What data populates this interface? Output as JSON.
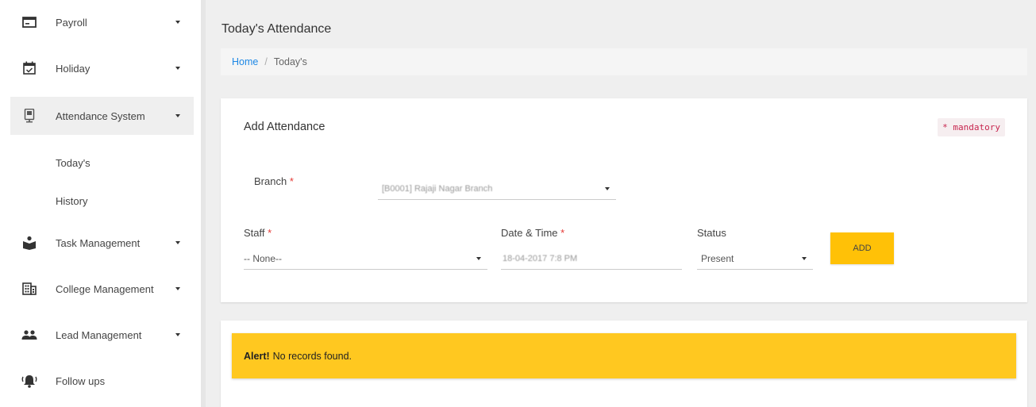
{
  "sidebar": {
    "items": [
      {
        "label": "Payroll",
        "icon": "payroll-icon"
      },
      {
        "label": "Holiday",
        "icon": "calendar-check-icon"
      },
      {
        "label": "Attendance System",
        "icon": "attendance-icon"
      },
      {
        "label": "Task Management",
        "icon": "task-icon"
      },
      {
        "label": "College Management",
        "icon": "building-icon"
      },
      {
        "label": "Lead Management",
        "icon": "people-icon"
      },
      {
        "label": "Follow ups",
        "icon": "bell-icon"
      }
    ],
    "subitems": [
      "Today's",
      "History"
    ]
  },
  "header": {
    "title": "Today's Attendance",
    "breadcrumb": {
      "home": "Home",
      "separator": "/",
      "current": "Today's"
    }
  },
  "form": {
    "title": "Add Attendance",
    "mandatory": "* mandatory",
    "branch": {
      "label": "Branch",
      "required": "*",
      "value": "[B0001] Rajaji Nagar Branch"
    },
    "staff": {
      "label": "Staff",
      "required": "*",
      "value": "-- None--"
    },
    "datetime": {
      "label": "Date & Time",
      "required": "*",
      "value": "18-04-2017 7:8 PM"
    },
    "status": {
      "label": "Status",
      "value": "Present"
    },
    "add_label": "ADD"
  },
  "alert": {
    "strong": "Alert!",
    "message": "No records found."
  },
  "colors": {
    "accent": "#ffc107",
    "link": "#1e88e5",
    "alert_bg": "#ffc820",
    "required": "#e53935"
  }
}
